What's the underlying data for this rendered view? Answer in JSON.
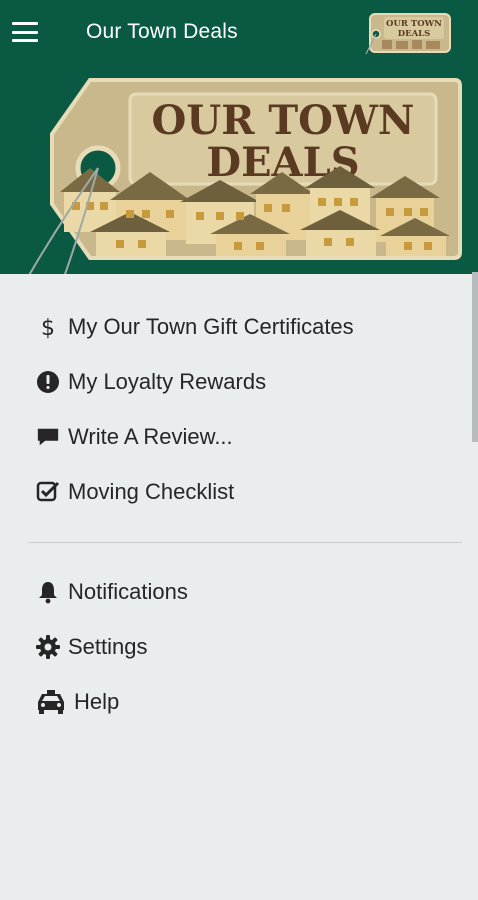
{
  "header": {
    "title": "Our Town Deals",
    "logo_text_line1": "OUR TOWN",
    "logo_text_line2": "DEALS"
  },
  "menu_primary": [
    {
      "label": "My Our Town Gift Certificates",
      "icon": "dollar-icon"
    },
    {
      "label": "My Loyalty Rewards",
      "icon": "exclamation-circle-icon"
    },
    {
      "label": "Write A Review...",
      "icon": "comment-icon"
    },
    {
      "label": "Moving Checklist",
      "icon": "checkbox-icon"
    }
  ],
  "menu_secondary": [
    {
      "label": "Notifications",
      "icon": "bell-icon"
    },
    {
      "label": "Settings",
      "icon": "gear-icon"
    },
    {
      "label": "Help",
      "icon": "taxi-icon"
    }
  ],
  "colors": {
    "header_bg": "#0a5a43",
    "drawer_bg": "#e9edee",
    "tag_tan": "#c9b88c",
    "logo_text": "#5a3b21"
  }
}
